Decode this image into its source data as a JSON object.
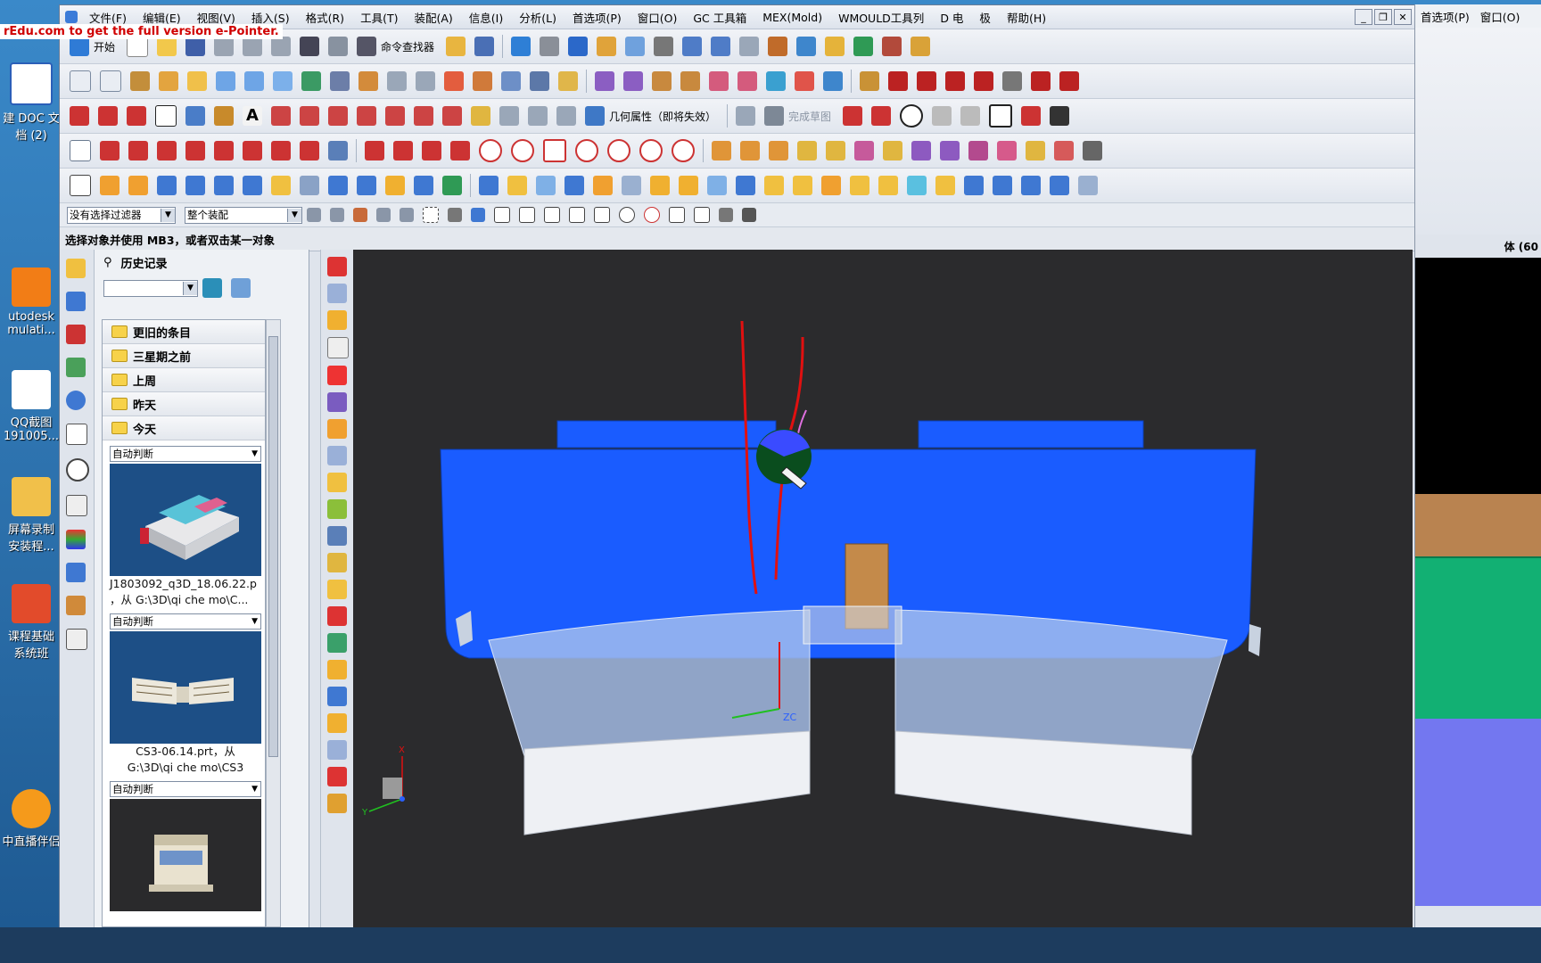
{
  "watermark": "rEdu.com to get the full version e-Pointer.",
  "desktop_icons": [
    {
      "label": "建 DOC 文\n档 (2)"
    },
    {
      "label": "utodesk\nmulati..."
    },
    {
      "label": "QQ截图\n191005..."
    },
    {
      "label": "屏幕录制\n安装程..."
    },
    {
      "label": "课程基础\n系统班"
    },
    {
      "label": "中直播伴侣"
    }
  ],
  "menubar": [
    "文件(F)",
    "编辑(E)",
    "视图(V)",
    "插入(S)",
    "格式(R)",
    "工具(T)",
    "装配(A)",
    "信息(I)",
    "分析(L)",
    "首选项(P)",
    "窗口(O)",
    "GC 工具箱",
    "MEX(Mold)",
    "WMOULD工具列",
    "D 电",
    "极",
    "帮助(H)"
  ],
  "toolbar": {
    "start_label": "开始",
    "command_finder": "命令查找器",
    "geometry_props": "几何属性（即将失效）",
    "finish_sketch": "完成草图"
  },
  "filter": {
    "selection": "没有选择过滤器",
    "scope": "整个装配"
  },
  "status": "选择对象并使用 MB3，或者双击某一对象",
  "history": {
    "title": "历史记录",
    "groups": [
      "更旧的条目",
      "三星期之前",
      "上周",
      "昨天",
      "今天"
    ],
    "mode_label": "自动判断",
    "items": [
      {
        "caption": "J1803092_q3D_18.06.22.p\n，从 G:\\3D\\qi che mo\\C..."
      },
      {
        "caption": "CS3-06.14.prt，从\nG:\\3D\\qi che mo\\CS3"
      },
      {
        "caption": ""
      }
    ]
  },
  "viewport": {
    "zc": "ZC",
    "axis_x": "X",
    "axis_y": "Y"
  },
  "rightwin": {
    "menus": [
      "首选项(P)",
      "窗口(O)"
    ],
    "status_frag": "体 (60"
  },
  "colors": {
    "model_blue": "#1a5cff",
    "brown": "#c48a4a",
    "sketch_red": "#e01010"
  }
}
